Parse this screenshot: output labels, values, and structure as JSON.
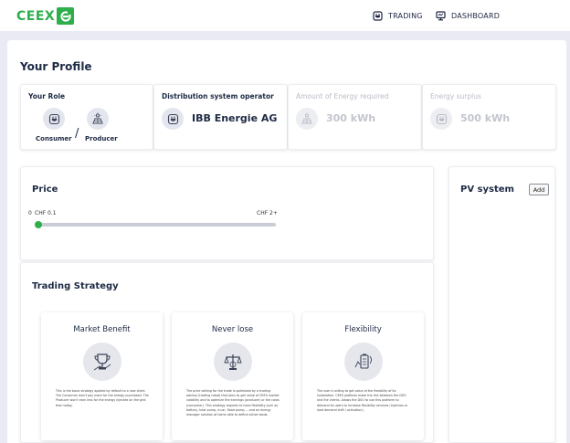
{
  "header": {
    "logo_text": "CEEX",
    "nav": [
      {
        "label": "TRADING",
        "icon": "plug-icon"
      },
      {
        "label": "DASHBOARD",
        "icon": "monitor-icon"
      }
    ]
  },
  "profile": {
    "title": "Your Profile",
    "role": {
      "label": "Your Role",
      "consumer": "Consumer",
      "separator": "/",
      "producer": "Producer"
    },
    "dso": {
      "label": "Distribution system operator",
      "value": "IBB Energie AG"
    },
    "energy_required": {
      "label": "Amount of Energy required",
      "value": "300 kWh"
    },
    "energy_surplus": {
      "label": "Energy surplus",
      "value": "500 kWh"
    }
  },
  "price": {
    "title": "Price",
    "min_label": "0",
    "start_label": "CHF 0.1",
    "end_label": "CHF 2+",
    "slider_position": 0
  },
  "pv_system": {
    "title": "PV system",
    "add_label": "Add"
  },
  "trading_strategy": {
    "title": "Trading Strategy",
    "cards": [
      {
        "title": "Market Benefit",
        "icon": "trophy-icon",
        "description": "This is the basic strategy applied by default to a new client. The Consumer won't pay more for the energy purchased. The Producer won't earn less for the energy injected on the grid than today."
      },
      {
        "title": "Never lose",
        "icon": "balance-icon",
        "description": "The price setting for the trade is optimized by a trading advisor (trading robot) that aims to get value of CEEX market volatility and to optimize the earnings (producer) or the costs (consumer). This strategy requires to have flexibility such as battery, heat pump, e-car, flood pump,... and an energy manager solution at home able to define active loads."
      },
      {
        "title": "Flexibility",
        "icon": "flexibility-icon",
        "description": "The user is willing to get value of the flexibility of its installation. CEEX platform make the link between the DSO and the clients. Allows the DSO to use this platform to demand its users to increase flexibility services (injection or load demand shift / activation)."
      }
    ]
  }
}
